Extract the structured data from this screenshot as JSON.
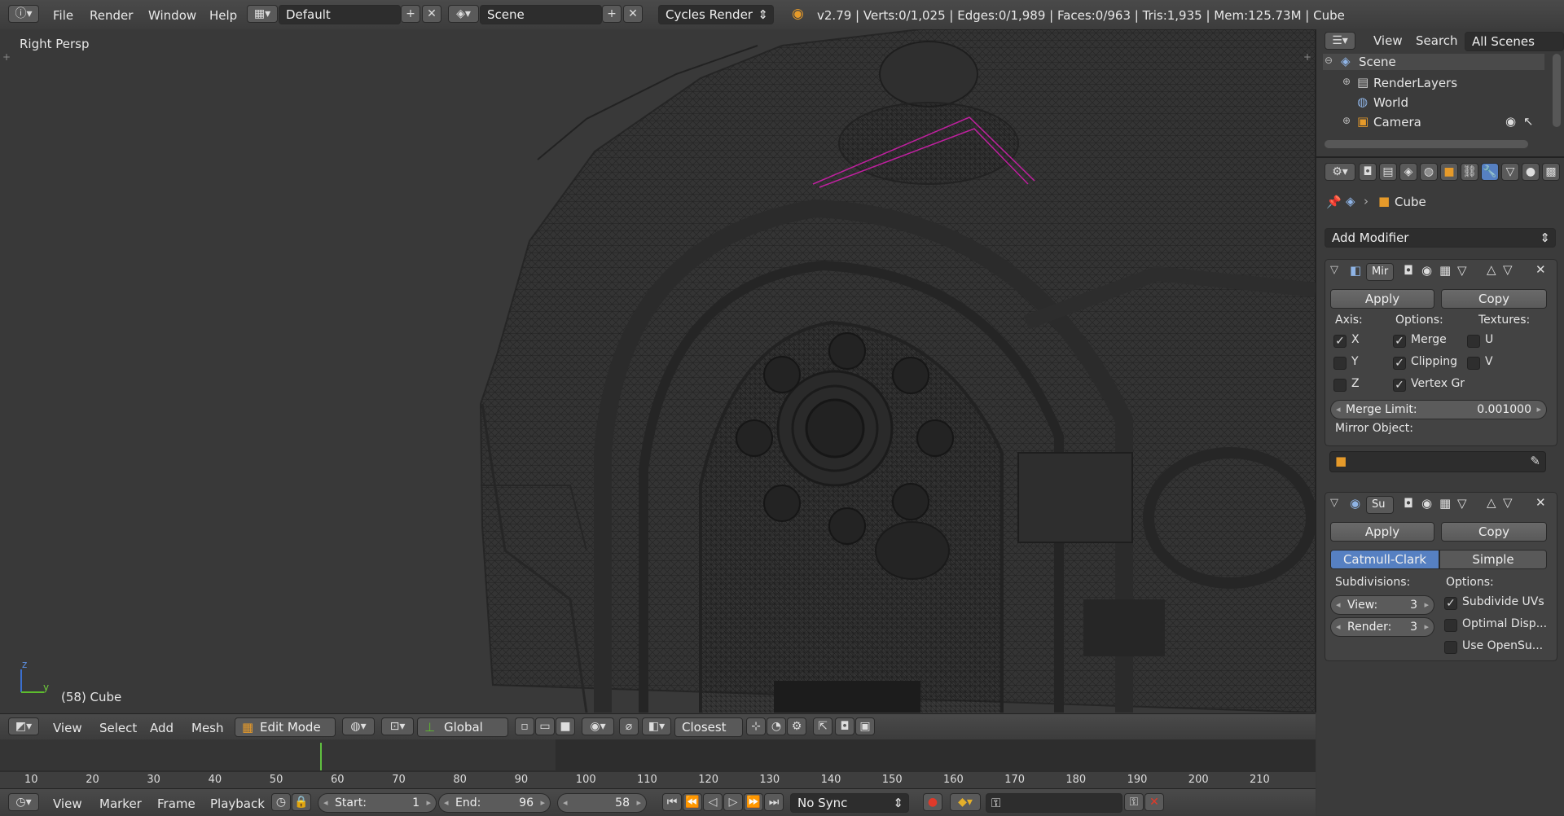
{
  "top": {
    "menu": [
      "File",
      "Render",
      "Window",
      "Help"
    ],
    "screen_layout": "Default",
    "scene": "Scene",
    "render_engine": "Cycles Render",
    "stats": "v2.79 | Verts:0/1,025 | Edges:0/1,989 | Faces:0/963 | Tris:1,935 | Mem:125.73M | Cube"
  },
  "viewport": {
    "view_label": "Right Persp",
    "object_label": "(58) Cube",
    "axis_z": "z",
    "axis_y": "y"
  },
  "outliner": {
    "menu": [
      "View",
      "Search"
    ],
    "filter": "All Scenes",
    "items": [
      "Scene",
      "RenderLayers",
      "World",
      "Camera"
    ]
  },
  "properties": {
    "context_object": "Cube",
    "add_modifier": "Add Modifier",
    "mirror": {
      "name": "Mir",
      "apply": "Apply",
      "copy": "Copy",
      "axis_label": "Axis:",
      "options_label": "Options:",
      "textures_label": "Textures:",
      "axis": [
        {
          "label": "X",
          "checked": true
        },
        {
          "label": "Y",
          "checked": false
        },
        {
          "label": "Z",
          "checked": false
        }
      ],
      "options": [
        {
          "label": "Merge",
          "checked": true
        },
        {
          "label": "Clipping",
          "checked": true
        },
        {
          "label": "Vertex Gr",
          "checked": true
        }
      ],
      "textures": [
        {
          "label": "U",
          "checked": false
        },
        {
          "label": "V",
          "checked": false
        }
      ],
      "merge_limit_label": "Merge Limit:",
      "merge_limit_value": "0.001000",
      "mirror_object_label": "Mirror Object:"
    },
    "subsurf": {
      "name": "Su",
      "apply": "Apply",
      "copy": "Copy",
      "tab_catmull": "Catmull-Clark",
      "tab_simple": "Simple",
      "subdivisions_label": "Subdivisions:",
      "options_label": "Options:",
      "view_label": "View:",
      "view_value": "3",
      "render_label": "Render:",
      "render_value": "3",
      "options": [
        {
          "label": "Subdivide UVs",
          "checked": true
        },
        {
          "label": "Optimal Disp...",
          "checked": false
        },
        {
          "label": "Use OpenSu...",
          "checked": false
        }
      ]
    }
  },
  "view3d_header": {
    "menu": [
      "View",
      "Select",
      "Add",
      "Mesh"
    ],
    "mode": "Edit Mode",
    "orientation": "Global",
    "snap": "Closest"
  },
  "timeline": {
    "ticks": [
      "10",
      "20",
      "30",
      "40",
      "50",
      "60",
      "70",
      "80",
      "90",
      "100",
      "110",
      "120",
      "130",
      "140",
      "150",
      "160",
      "170",
      "180",
      "190",
      "200",
      "210"
    ],
    "current_frame": 58,
    "menu": [
      "View",
      "Marker",
      "Frame",
      "Playback"
    ],
    "start_label": "Start:",
    "start_value": "1",
    "end_label": "End:",
    "end_value": "96",
    "frame_value": "58",
    "sync": "No Sync"
  },
  "colors": {
    "accent_blue": "#5680c2",
    "selection_magenta": "#c020a0",
    "playhead_green": "#60c040"
  }
}
